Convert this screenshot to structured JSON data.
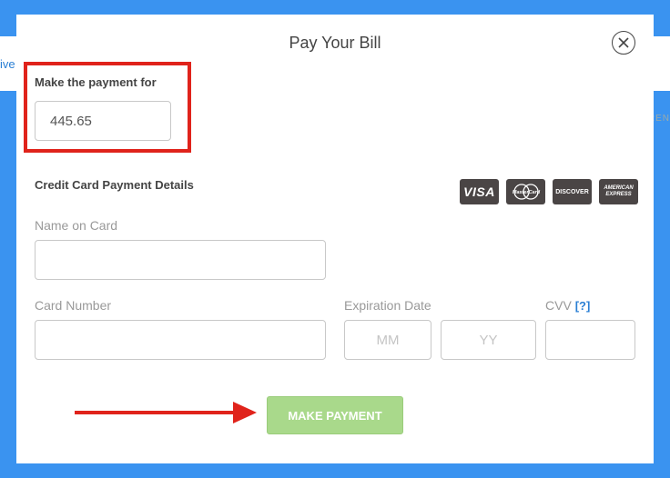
{
  "background": {
    "left_text": "ive",
    "right_text": "REN"
  },
  "modal": {
    "title": "Pay Your Bill",
    "close_icon": "close-circle-icon"
  },
  "payment": {
    "label": "Make the payment for",
    "amount": "445.65"
  },
  "card_details": {
    "title": "Credit Card Payment Details",
    "logos": [
      "VISA",
      "MasterCard",
      "DISCOVER",
      "AMERICAN EXPRESS"
    ]
  },
  "fields": {
    "name_label": "Name on Card",
    "name_value": "",
    "card_number_label": "Card Number",
    "card_number_value": "",
    "expiration_label": "Expiration Date",
    "month_placeholder": "MM",
    "year_placeholder": "YY",
    "cvv_label": "CVV",
    "cvv_help": "[?]",
    "cvv_value": ""
  },
  "actions": {
    "make_payment": "MAKE PAYMENT"
  },
  "colors": {
    "background": "#3a93f0",
    "highlight": "#e0231b",
    "button": "#a9d98b",
    "link": "#2a7fd4"
  }
}
